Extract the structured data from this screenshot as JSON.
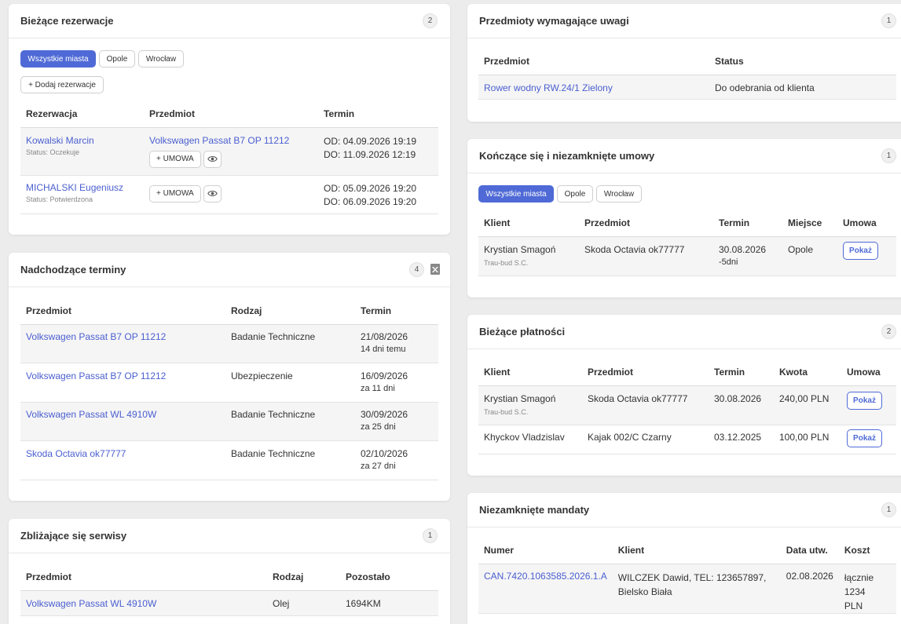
{
  "reservations": {
    "title": "Bieżące rezerwacje",
    "count": "2",
    "filters": [
      "Wszystkie miasta",
      "Opole",
      "Wrocław"
    ],
    "add_label": "+ Dodaj rezerwacje",
    "columns": [
      "Rezerwacja",
      "Przedmiot",
      "Termin"
    ],
    "rows": [
      {
        "name": "Kowalski Marcin",
        "status": "Status: Oczekuje",
        "item": "Volkswagen Passat B7 OP 11212",
        "umowa": "+ UMOWA",
        "from": "OD: 04.09.2026 19:19",
        "to": "DO: 11.09.2026 12:19"
      },
      {
        "name": "MICHALSKI Eugeniusz",
        "status": "Status: Potwierdzona",
        "item": "",
        "umowa": "+ UMOWA",
        "from": "OD: 05.09.2026 19:20",
        "to": "DO: 06.09.2026 19:20"
      }
    ]
  },
  "upcoming": {
    "title": "Nadchodzące terminy",
    "count": "4",
    "columns": [
      "Przedmiot",
      "Rodzaj",
      "Termin"
    ],
    "rows": [
      {
        "item": "Volkswagen Passat B7 OP 11212",
        "type": "Badanie Techniczne",
        "date": "21/08/2026",
        "rel": "14 dni temu"
      },
      {
        "item": "Volkswagen Passat B7 OP 11212",
        "type": "Ubezpieczenie",
        "date": "16/09/2026",
        "rel": "za 11 dni"
      },
      {
        "item": "Volkswagen Passat WL 4910W",
        "type": "Badanie Techniczne",
        "date": "30/09/2026",
        "rel": "za 25 dni"
      },
      {
        "item": "Skoda Octavia ok77777",
        "type": "Badanie Techniczne",
        "date": "02/10/2026",
        "rel": "za 27 dni"
      }
    ]
  },
  "services": {
    "title": "Zbliżające się serwisy",
    "count": "1",
    "columns": [
      "Przedmiot",
      "Rodzaj",
      "Pozostało"
    ],
    "rows": [
      {
        "item": "Volkswagen Passat WL 4910W",
        "type": "Olej",
        "left": "1694KM"
      }
    ]
  },
  "attention": {
    "title": "Przedmioty wymagające uwagi",
    "count": "1",
    "columns": [
      "Przedmiot",
      "Status"
    ],
    "rows": [
      {
        "item": "Rower wodny RW.24/1 Zielony",
        "status": "Do odebrania od klienta"
      }
    ]
  },
  "ending": {
    "title": "Kończące się i niezamknięte umowy",
    "count": "1",
    "filters": [
      "Wszystkie miasta",
      "Opole",
      "Wrocław"
    ],
    "columns": [
      "Klient",
      "Przedmiot",
      "Termin",
      "Miejsce",
      "Umowa"
    ],
    "rows": [
      {
        "client": "Krystian Smagoń",
        "company": "Trau-bud S.C.",
        "item": "Skoda Octavia ok77777",
        "date": "30.08.2026",
        "rel": "-5dni",
        "place": "Opole",
        "btn": "Pokaż"
      }
    ]
  },
  "payments": {
    "title": "Bieżące płatności",
    "count": "2",
    "columns": [
      "Klient",
      "Przedmiot",
      "Termin",
      "Kwota",
      "Umowa"
    ],
    "rows": [
      {
        "client": "Krystian Smagoń",
        "company": "Trau-bud S.C.",
        "item": "Skoda Octavia ok77777",
        "date": "30.08.2026",
        "amount": "240,00 PLN",
        "btn": "Pokaż"
      },
      {
        "client": "Khyckov Vladzislav",
        "company": "",
        "item": "Kajak 002/C Czarny",
        "date": "03.12.2025",
        "amount": "100,00 PLN",
        "btn": "Pokaż"
      }
    ]
  },
  "fines": {
    "title": "Niezamknięte mandaty",
    "count": "1",
    "columns": [
      "Numer",
      "Klient",
      "Data utw.",
      "Koszt"
    ],
    "rows": [
      {
        "number": "CAN.7420.1063585.2026.1.A",
        "client_line1": "WILCZEK Dawid, TEL: 123657897,",
        "client_line2": "Bielsko Biała",
        "date": "02.08.2026",
        "cost_line1": "łącznie 1234",
        "cost_line2": "PLN"
      }
    ]
  },
  "icons": {
    "eye": "eye-icon",
    "excel": "excel-export-icon"
  },
  "colors": {
    "accent": "#4f6ad6",
    "link": "#4a5ed0"
  }
}
